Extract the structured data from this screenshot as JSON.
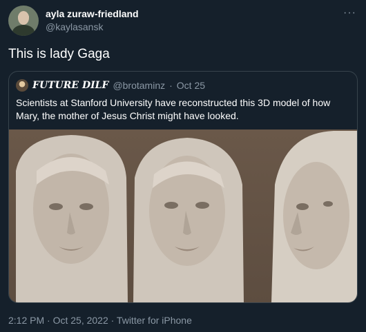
{
  "author": {
    "display_name": "ayla zuraw-friedland",
    "handle": "@kaylasansk"
  },
  "menu_icon": "more-horizontal-icon",
  "tweet": {
    "text": "This is lady Gaga",
    "timestamp": "2:12 PM · Oct 25, 2022 · Twitter for iPhone"
  },
  "quoted": {
    "display_name": "FUTURE DILF",
    "handle": "@brotaminz",
    "date": "Oct 25",
    "text": "Scientists at Stanford University have reconstructed this 3D model of how Mary, the mother of Jesus Christ might have looked."
  },
  "colors": {
    "background": "#15202b",
    "text": "#ffffff",
    "muted": "#8b98a5",
    "border": "#38444d"
  }
}
